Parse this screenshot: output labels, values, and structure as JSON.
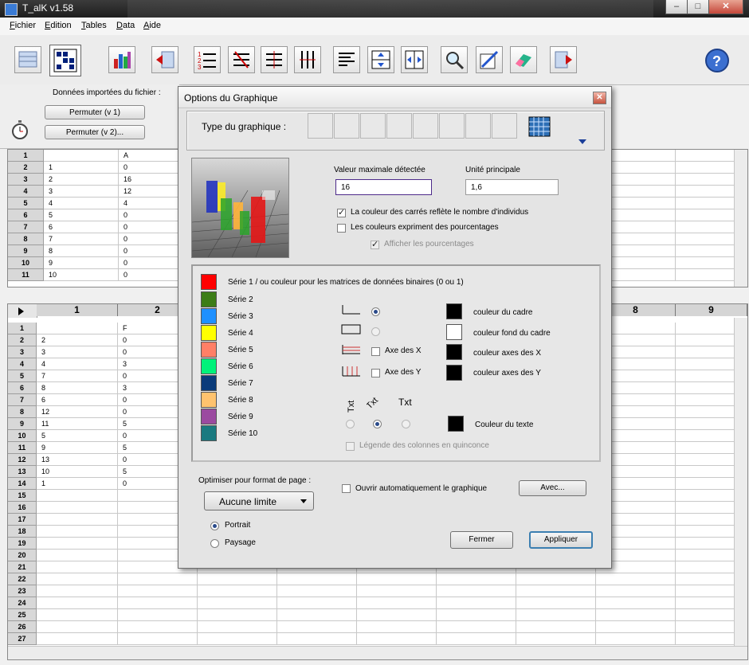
{
  "window": {
    "title": "T_alK v1.58"
  },
  "menu": [
    "Fichier",
    "Edition",
    "Tables",
    "Data",
    "Aide"
  ],
  "toolbar_icons": [
    "data-icon",
    "matrix-icon",
    "bar-chart-icon",
    "import-icon",
    "sort-desc-icon",
    "transpose-icon",
    "filter-icon",
    "columns-icon",
    "text-align-icon",
    "split-rows-icon",
    "split-cols-icon",
    "search-icon",
    "edit-icon",
    "eraser-icon",
    "export-icon",
    "help-icon"
  ],
  "left_panel": {
    "title": "Données importées du fichier :",
    "permute_v1": "Permuter (v 1)",
    "permute_v2": "Permuter (v 2)..."
  },
  "grid_top": {
    "col_a_header": "A",
    "rows": [
      {
        "n": "1",
        "a": "",
        "b": "A"
      },
      {
        "n": "2",
        "a": "1",
        "b": "0"
      },
      {
        "n": "3",
        "a": "2",
        "b": "16"
      },
      {
        "n": "4",
        "a": "3",
        "b": "12"
      },
      {
        "n": "5",
        "a": "4",
        "b": "4"
      },
      {
        "n": "6",
        "a": "5",
        "b": "0"
      },
      {
        "n": "7",
        "a": "6",
        "b": "0"
      },
      {
        "n": "8",
        "a": "7",
        "b": "0"
      },
      {
        "n": "9",
        "a": "8",
        "b": "0"
      },
      {
        "n": "10",
        "a": "9",
        "b": "0"
      },
      {
        "n": "11",
        "a": "10",
        "b": "0"
      }
    ]
  },
  "grid_bottom": {
    "col_headers": [
      "1",
      "2",
      "8",
      "9"
    ],
    "rows": [
      {
        "n": "1",
        "a": "",
        "b": "F"
      },
      {
        "n": "2",
        "a": "2",
        "b": "0"
      },
      {
        "n": "3",
        "a": "3",
        "b": "0"
      },
      {
        "n": "4",
        "a": "4",
        "b": "3"
      },
      {
        "n": "5",
        "a": "7",
        "b": "0"
      },
      {
        "n": "6",
        "a": "8",
        "b": "3"
      },
      {
        "n": "7",
        "a": "6",
        "b": "0"
      },
      {
        "n": "8",
        "a": "12",
        "b": "0"
      },
      {
        "n": "9",
        "a": "11",
        "b": "5"
      },
      {
        "n": "10",
        "a": "5",
        "b": "0"
      },
      {
        "n": "11",
        "a": "9",
        "b": "5"
      },
      {
        "n": "12",
        "a": "13",
        "b": "0"
      },
      {
        "n": "13",
        "a": "10",
        "b": "5"
      },
      {
        "n": "14",
        "a": "1",
        "b": "0"
      },
      {
        "n": "15",
        "a": "",
        "b": ""
      },
      {
        "n": "16",
        "a": "",
        "b": ""
      },
      {
        "n": "17",
        "a": "",
        "b": ""
      },
      {
        "n": "18",
        "a": "",
        "b": ""
      },
      {
        "n": "19",
        "a": "",
        "b": ""
      },
      {
        "n": "20",
        "a": "",
        "b": ""
      },
      {
        "n": "21",
        "a": "",
        "b": ""
      },
      {
        "n": "22",
        "a": "",
        "b": ""
      },
      {
        "n": "23",
        "a": "",
        "b": ""
      },
      {
        "n": "24",
        "a": "",
        "b": ""
      },
      {
        "n": "25",
        "a": "",
        "b": ""
      },
      {
        "n": "26",
        "a": "",
        "b": ""
      },
      {
        "n": "27",
        "a": "",
        "b": ""
      }
    ]
  },
  "dialog": {
    "title": "Options du Graphique",
    "type_label": "Type du graphique :",
    "max_value_label": "Valeur maximale détectée",
    "max_value": "16",
    "unit_label": "Unité principale",
    "unit_value": "1,6",
    "cb_squares_color": "La couleur des carrés reflète le nombre d'individus",
    "cb_percent_colors": "Les couleurs expriment des pourcentages",
    "cb_show_percent": "Afficher les pourcentages",
    "series": [
      {
        "label": "Série 1 / ou couleur pour les matrices de données binaires (0 ou 1)",
        "color": "#ff0000"
      },
      {
        "label": "Série 2",
        "color": "#3c7d17"
      },
      {
        "label": "Série 3",
        "color": "#1e90ff"
      },
      {
        "label": "Série 4",
        "color": "#ffff00"
      },
      {
        "label": "Série 5",
        "color": "#ff7f66"
      },
      {
        "label": "Série 6",
        "color": "#00f27a"
      },
      {
        "label": "Série 7",
        "color": "#0a3b7a"
      },
      {
        "label": "Série 8",
        "color": "#ffc36e"
      },
      {
        "label": "Série 9",
        "color": "#9b4aa0"
      },
      {
        "label": "Série 10",
        "color": "#1a7a80"
      }
    ],
    "axe_x": "Axe des X",
    "axe_y": "Axe des Y",
    "txt_label": "Txt",
    "colors": [
      {
        "label": "couleur du cadre",
        "color": "#000000"
      },
      {
        "label": "couleur fond du cadre",
        "color": "#ffffff"
      },
      {
        "label": "couleur axes des X",
        "color": "#000000"
      },
      {
        "label": "couleur axes des Y",
        "color": "#000000"
      },
      {
        "label": "Couleur du texte",
        "color": "#000000"
      }
    ],
    "legend_quinconce": "Légende des colonnes en quinconce",
    "optimize_label": "Optimiser pour format de page :",
    "page_format": "Aucune limite",
    "portrait": "Portrait",
    "paysage": "Paysage",
    "auto_open": "Ouvrir automatiquement le graphique",
    "avec": "Avec...",
    "fermer": "Fermer",
    "appliquer": "Appliquer"
  }
}
